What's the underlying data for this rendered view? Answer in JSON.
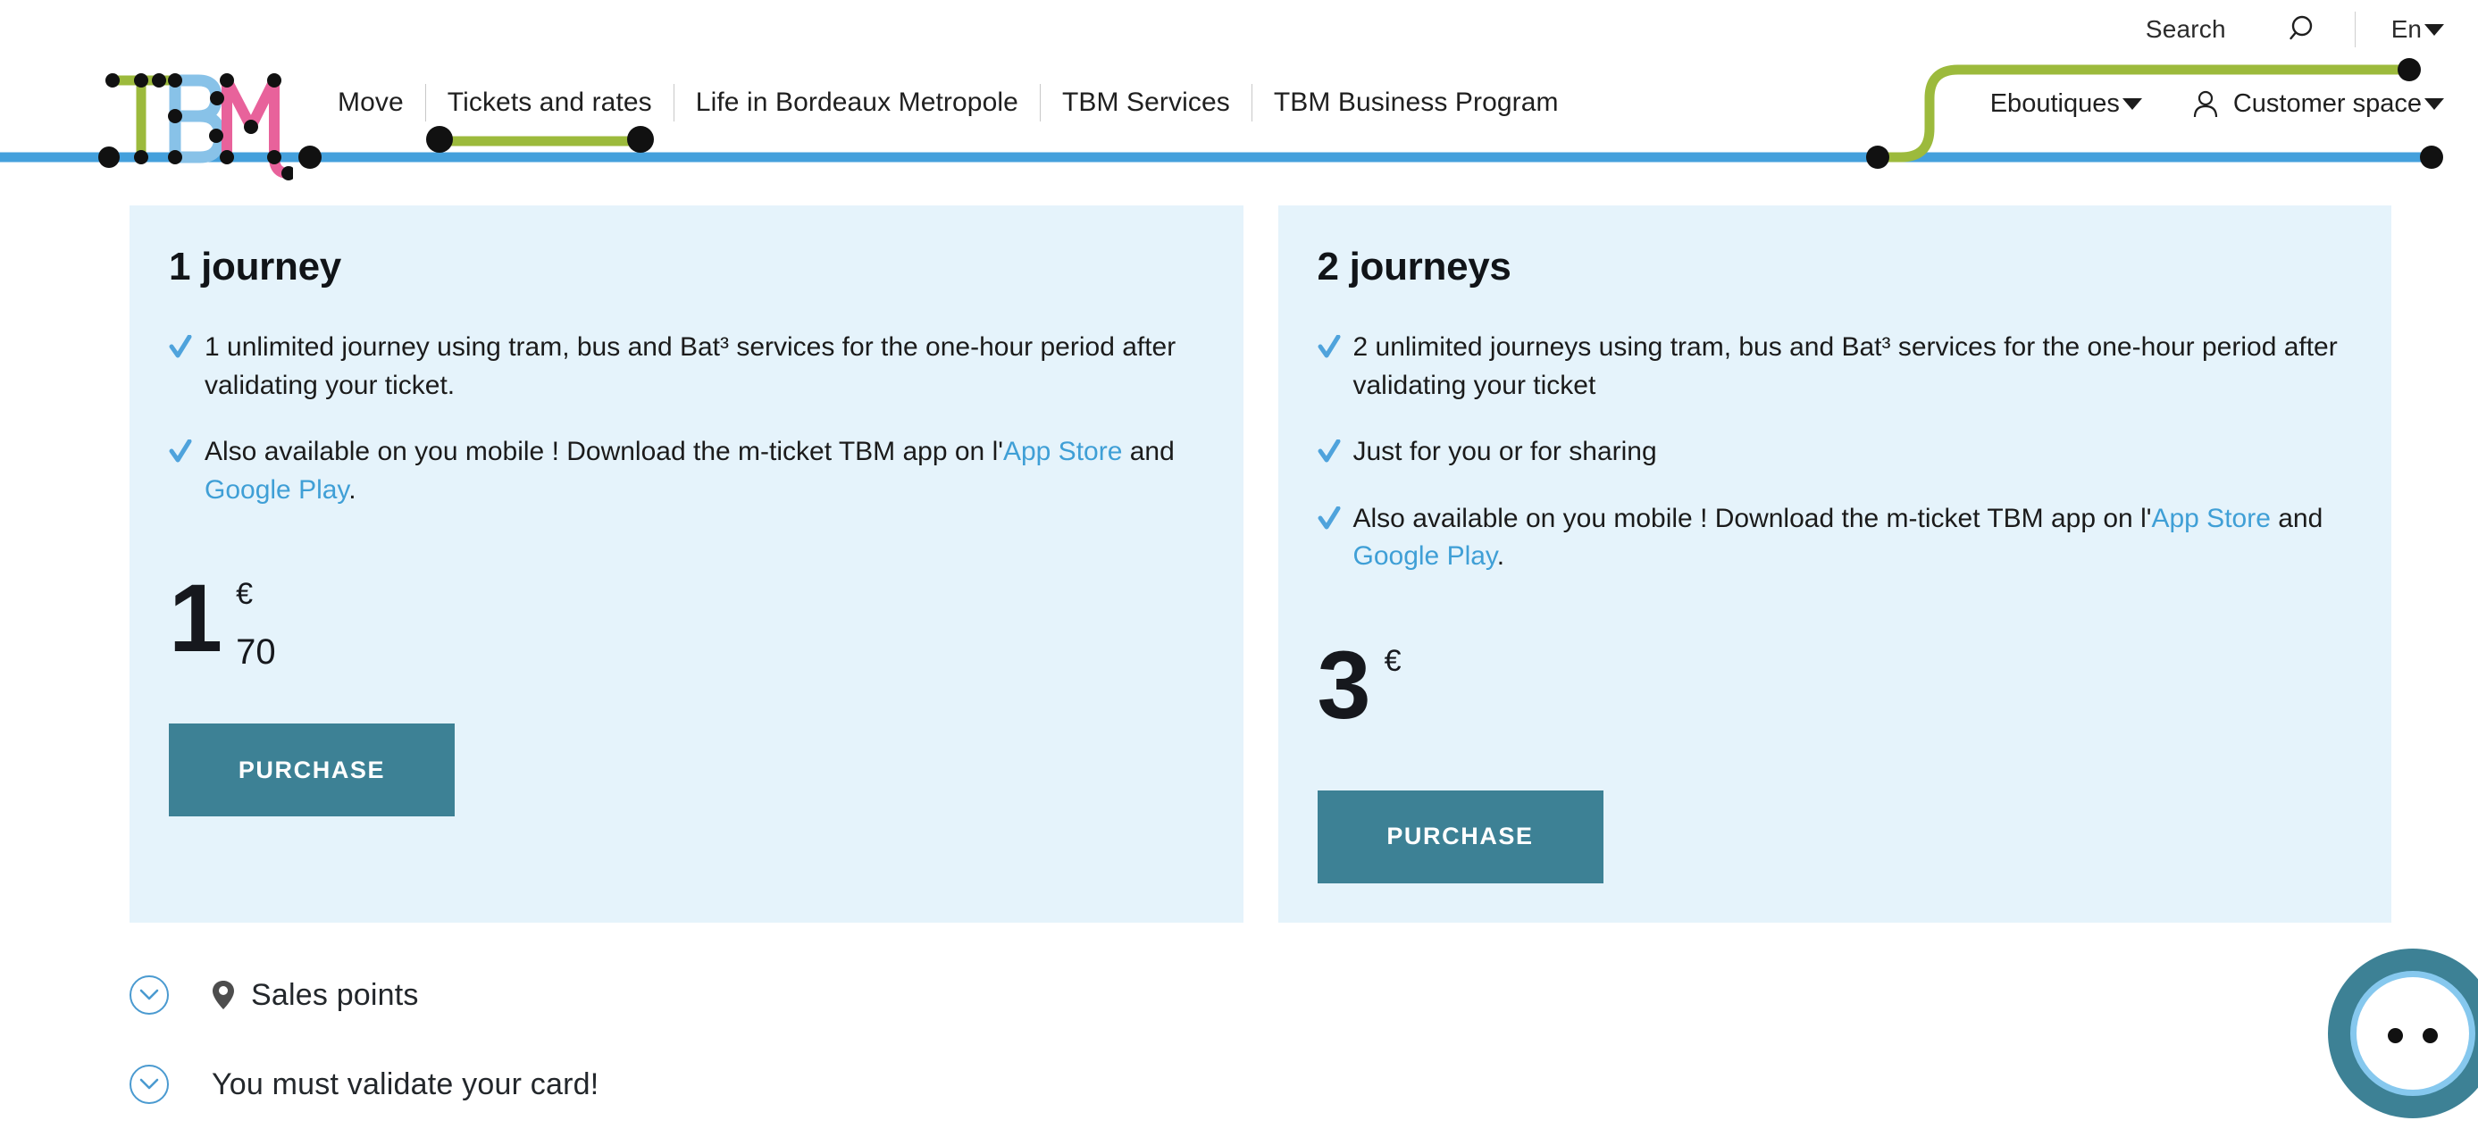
{
  "topbar": {
    "search_label": "Search",
    "search_icon": "search-icon",
    "language": "En",
    "language_caret": "chevron-down-icon"
  },
  "logo": {
    "alt": "TBM",
    "letters": [
      "T",
      "B",
      "M"
    ],
    "colors": {
      "green": "#9CBA3C",
      "blue": "#88C2E8",
      "pink": "#E8629B"
    }
  },
  "nav": {
    "items": [
      {
        "label": "Move",
        "active": false
      },
      {
        "label": "Tickets and rates",
        "active": true
      },
      {
        "label": "Life in Bordeaux Metropole",
        "active": false
      },
      {
        "label": "TBM Services",
        "active": false
      },
      {
        "label": "TBM Business Program",
        "active": false
      }
    ]
  },
  "rightnav": {
    "eboutiques": {
      "label": "Eboutiques",
      "caret": "chevron-down-icon"
    },
    "customer_space": {
      "label": "Customer space",
      "icon": "person-icon",
      "caret": "chevron-down-icon"
    }
  },
  "colors": {
    "green_line": "#9CBA3C",
    "blue_line": "#44A0DC",
    "card_bg": "#E5F3FB",
    "button_bg": "#3D8195",
    "link": "#3F9FD6",
    "check": "#4FA3DC"
  },
  "cards": [
    {
      "title": "1 journey",
      "features": [
        {
          "pre": "1 unlimited journey using tram, bus and Bat³ services for the one-hour period after validating your ticket.",
          "links": []
        },
        {
          "pre": "Also available on you mobile ! Download the m-ticket TBM app on l'",
          "link1": "App Store",
          "mid": " and ",
          "link2": "Google Play",
          "post": "."
        }
      ],
      "price": {
        "integer": "1",
        "currency": "€",
        "decimal": "70"
      },
      "button": "PURCHASE"
    },
    {
      "title": "2 journeys",
      "features": [
        {
          "pre": "2 unlimited journeys using tram, bus and Bat³ services for the one-hour period after validating your ticket",
          "links": []
        },
        {
          "pre": "Just for you or for sharing",
          "links": []
        },
        {
          "pre": "Also available on you mobile ! Download the m-ticket TBM app on l'",
          "link1": "App Store",
          "mid": " and ",
          "link2": "Google Play",
          "post": "."
        }
      ],
      "price": {
        "integer": "3",
        "currency": "€",
        "decimal": ""
      },
      "button": "PURCHASE"
    }
  ],
  "accordions": [
    {
      "label": "Sales points",
      "icon": "map-pin-icon",
      "chevron": "chevron-down-icon",
      "expanded": false
    },
    {
      "label": "You must validate your card!",
      "icon": "",
      "chevron": "chevron-down-icon",
      "expanded": false
    }
  ],
  "chat_widget": {
    "name": "chat-assistant-avatar"
  }
}
